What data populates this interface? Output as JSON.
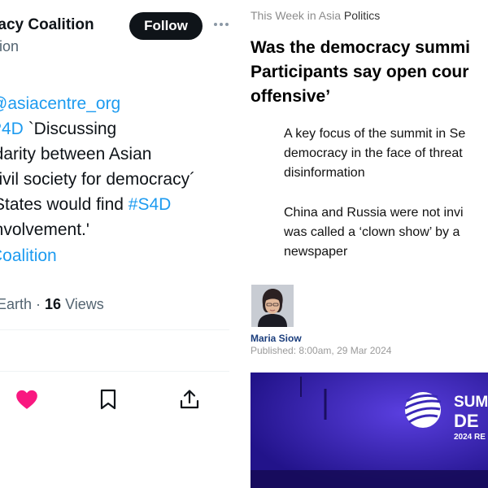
{
  "tweet": {
    "account_name": "racy Coalition",
    "account_sub": "ition",
    "follow_label": "Follow",
    "text_lines": [
      {
        "parts": [
          {
            "t": "@asiacentre_org",
            "link": true
          }
        ]
      },
      {
        "parts": [
          {
            "t": "P4D",
            "link": true
          },
          {
            "t": " `Discussing",
            "link": false
          }
        ]
      },
      {
        "parts": [
          {
            "t": "idarity between Asian",
            "link": false
          }
        ]
      },
      {
        "parts": [
          {
            "t": "civil society for democracy´",
            "link": false
          }
        ]
      },
      {
        "parts": [
          {
            "t": " 'States would find ",
            "link": false
          },
          {
            "t": "#S4D",
            "link": true
          }
        ]
      },
      {
        "parts": [
          {
            "t": "involvement.'",
            "link": false
          }
        ]
      },
      {
        "parts": [
          {
            "t": "Coalition",
            "link": true
          }
        ]
      }
    ],
    "meta_place": "Earth · ",
    "views_count": "16",
    "views_label": " Views",
    "actions": [
      "heart-icon",
      "bookmark-icon",
      "share-icon"
    ],
    "colors": {
      "link": "#1d9bf0",
      "like": "#f91880",
      "follow_bg": "#0f1419"
    }
  },
  "article": {
    "series": "This Week in Asia",
    "category": "Politics",
    "headline_lines": [
      "Was the democracy summi",
      "Participants say open cour",
      "offensive’"
    ],
    "points": [
      [
        "A key focus of the summit in Se",
        "democracy in the face of threat",
        "disinformation"
      ],
      [
        "China and Russia were not invi",
        "was called a ‘clown show’ by a",
        "newspaper"
      ]
    ],
    "author": "Maria Siow",
    "published": "Published: 8:00am, 29 Mar 2024",
    "hero_text": {
      "line1": "SUM",
      "line2": "DE",
      "line3": "2024 RE"
    }
  }
}
